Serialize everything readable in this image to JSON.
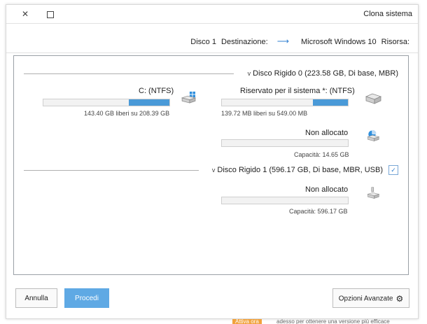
{
  "window": {
    "title": "Clona sistema",
    "close_glyph": "✕"
  },
  "route": {
    "source_label": "Risorsa:",
    "source_value": "Microsoft Windows 10",
    "dest_label": "Destinazione:",
    "dest_value": "Disco 1",
    "arrow_glyph": "⟶"
  },
  "disks": [
    {
      "header": "Disco Rigido 0 (223.58 GB, Di base, MBR)",
      "chevron": "v",
      "partitions": [
        {
          "name": "Riservato per il sistema *: (NTFS)",
          "info": "139.72 MB liberi su 549.00 MB",
          "used_fraction": 0.28
        },
        {
          "name": "C: (NTFS)",
          "info": "143.40 GB liberi su 208.39 GB",
          "used_fraction": 0.32
        },
        {
          "name": "Non allocato",
          "info": "Capacità: 14.65 GB",
          "used_fraction": 0
        }
      ]
    },
    {
      "header": "Disco Rigido 1 (596.17 GB, Di base, MBR, USB)",
      "chevron": "v",
      "check_glyph": "✓",
      "partitions": [
        {
          "name": "Non allocato",
          "info": "Capacità: 596.17 GB",
          "used_fraction": 0
        }
      ]
    }
  ],
  "buttons": {
    "cancel": "Annulla",
    "proceed": "Procedi",
    "advanced": "Opzioni Avanzate",
    "gear_glyph": "⚙"
  },
  "bottom_strip": {
    "text": "adesso per ottenere una versione più efficace",
    "activate": "Attiva ora"
  },
  "colors": {
    "accent": "#4a9ad8",
    "proceed_bg": "#5fa9e4",
    "activate_bg": "#f1a23d"
  }
}
